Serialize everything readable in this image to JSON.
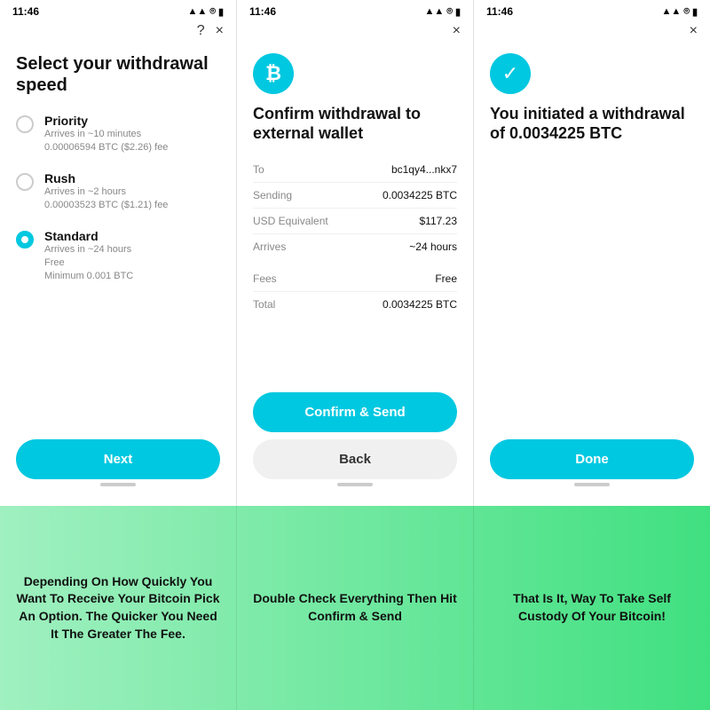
{
  "screens": [
    {
      "id": "speed-select",
      "status_time": "11:46",
      "header_icons": [
        "?",
        "×"
      ],
      "title": "Select your withdrawal speed",
      "options": [
        {
          "id": "priority",
          "label": "Priority",
          "desc": "Arrives in ~10 minutes\n0.00006594 BTC ($2.26) fee",
          "selected": false
        },
        {
          "id": "rush",
          "label": "Rush",
          "desc": "Arrives in ~2 hours\n0.00003523 BTC ($1.21) fee",
          "selected": false
        },
        {
          "id": "standard",
          "label": "Standard",
          "desc": "Arrives in ~24 hours\nFree\nMinimum 0.001 BTC",
          "selected": true
        }
      ],
      "button_label": "Next"
    },
    {
      "id": "confirm",
      "status_time": "11:46",
      "header_icons": [
        "×"
      ],
      "icon": "₿",
      "title": "Confirm withdrawal to external wallet",
      "details": [
        {
          "label": "To",
          "value": "bc1qy4...nkx7"
        },
        {
          "label": "Sending",
          "value": "0.0034225 BTC"
        },
        {
          "label": "USD Equivalent",
          "value": "$117.23"
        },
        {
          "label": "Arrives",
          "value": "~24 hours"
        }
      ],
      "details2": [
        {
          "label": "Fees",
          "value": "Free"
        },
        {
          "label": "Total",
          "value": "0.0034225 BTC"
        }
      ],
      "primary_button": "Confirm & Send",
      "secondary_button": "Back"
    },
    {
      "id": "success",
      "status_time": "11:46",
      "header_icons": [
        "×"
      ],
      "title": "You initiated a withdrawal of 0.0034225 BTC",
      "button_label": "Done"
    }
  ],
  "captions": [
    "Depending On How Quickly You Want To Receive Your Bitcoin Pick An Option. The Quicker You Need It The Greater The Fee.",
    "Double Check Everything Then Hit Confirm & Send",
    "That Is It, Way To Take Self Custody Of Your Bitcoin!"
  ]
}
